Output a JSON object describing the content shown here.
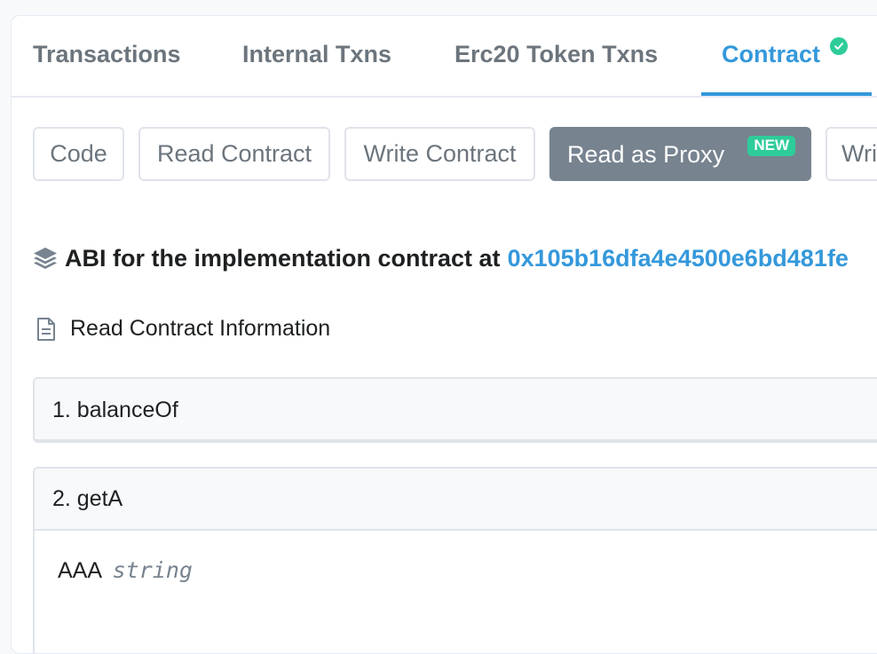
{
  "tabs": [
    {
      "label": "Transactions",
      "active": false
    },
    {
      "label": "Internal Txns",
      "active": false
    },
    {
      "label": "Erc20 Token Txns",
      "active": false
    },
    {
      "label": "Contract",
      "active": true,
      "verified_icon": "check-circle-icon"
    }
  ],
  "subtabs": [
    {
      "label": "Code",
      "active": false
    },
    {
      "label": "Read Contract",
      "active": false
    },
    {
      "label": "Write Contract",
      "active": false
    },
    {
      "label": "Read as Proxy",
      "active": true,
      "badge": "NEW"
    },
    {
      "label": "Wri",
      "active": false
    }
  ],
  "abi": {
    "icon": "layers-icon",
    "prefix": "ABI for the implementation contract at",
    "address": "0x105b16dfa4e4500e6bd481fe"
  },
  "read_info": {
    "icon": "document-icon",
    "label": "Read Contract Information"
  },
  "functions": [
    {
      "title": "1. balanceOf",
      "expanded": false
    },
    {
      "title": "2. getA",
      "expanded": true,
      "output_name": "AAA",
      "output_type": "string"
    }
  ],
  "colors": {
    "accent": "#3498db",
    "active_button": "#77838f",
    "badge": "#2ecc9a"
  }
}
